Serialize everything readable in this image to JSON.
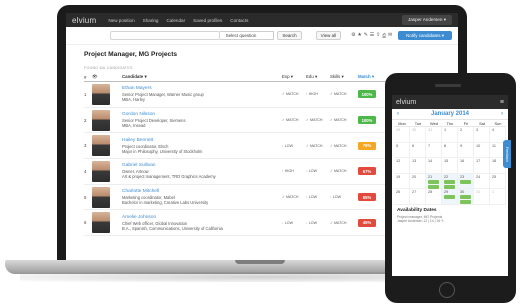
{
  "app": {
    "logo": "elvium",
    "user_menu": "Jasper Andersen ▾"
  },
  "nav": [
    "New position",
    "Sharing",
    "Calendar",
    "Saved profiles",
    "Contacts"
  ],
  "toolbar": {
    "search_placeholder": "",
    "select_label": "Select question",
    "search_button": "Search",
    "view_all": "View all",
    "icons": [
      "settings-icon",
      "star-icon",
      "edit-icon",
      "list-icon",
      "share-icon",
      "print-icon",
      "mail-icon"
    ],
    "notify_button": "Notify candidates ▾"
  },
  "page": {
    "title": "Project Manager, MG Projects",
    "found_label": "FOUND 6/6 CANDIDATES",
    "columns": {
      "num": "#",
      "candidate": "Candidate ▾",
      "exp": "Exp ▾",
      "edu": "Edu ▾",
      "skills": "Skills ▾",
      "match": "Match ▾"
    }
  },
  "candidates": [
    {
      "num": "1",
      "name": "Ethan Mayers",
      "line1": "Senior Project Manager, Warner Music group",
      "line2": "MBA, Harley",
      "exp": "MATCH",
      "edu": "HIGH",
      "skills": "MATCH",
      "match": "100%",
      "match_color": "#4cb848"
    },
    {
      "num": "2",
      "name": "Gordon Nilsson",
      "line1": "Senior Project Developer, Siemens",
      "line2": "MBA, Insead",
      "exp": "MATCH",
      "edu": "MATCH",
      "skills": "MATCH",
      "match": "100%",
      "match_color": "#4cb848"
    },
    {
      "num": "3",
      "name": "Hailey Bennett",
      "line1": "Project coordinator, Elsch",
      "line2": "Major in Philosophy, University of Stockholm",
      "exp": "LOW",
      "edu": "MATCH",
      "skills": "MATCH",
      "match": "75%",
      "match_color": "#f5a623"
    },
    {
      "num": "4",
      "name": "Gabriel Sullivan",
      "line1": "Owner, Artnow",
      "line2": "Art & project management, TRD Graphics Academy",
      "exp": "HIGH",
      "edu": "LOW",
      "skills": "MATCH",
      "match": "67%",
      "match_color": "#e24a3b"
    },
    {
      "num": "5",
      "name": "Charlotte Mitchell",
      "line1": "Marketing coordinator, Mabel",
      "line2": "Bachelor in marketing, Creative Labs University",
      "exp": "MATCH",
      "edu": "LOW",
      "skills": "LOW",
      "match": "65%",
      "match_color": "#e24a3b"
    },
    {
      "num": "6",
      "name": "Amelie Johnson",
      "line1": "Chief Web officer, Global Innovation",
      "line2": "B.A., Spanish, Communications, University of California",
      "exp": "LOW",
      "edu": "LOW",
      "skills": "MATCH",
      "match": "45%",
      "match_color": "#e24a3b"
    }
  ],
  "mobile": {
    "logo": "elvium",
    "menu_icon": "menu-icon",
    "calendar": {
      "title": "January 2014",
      "prev": "‹",
      "next": "›",
      "weekdays": [
        "Mon",
        "Tue",
        "Wed",
        "Thu",
        "Fri",
        "Sat",
        "Sun"
      ],
      "weeks": [
        [
          "29",
          "30",
          "31",
          "1",
          "2",
          "3",
          "4"
        ],
        [
          "5",
          "6",
          "7",
          "8",
          "9",
          "10",
          "11"
        ],
        [
          "12",
          "13",
          "14",
          "15",
          "16",
          "17",
          "18"
        ],
        [
          "19",
          "20",
          "21",
          "22",
          "23",
          "24",
          "25"
        ],
        [
          "26",
          "27",
          "28",
          "29",
          "30",
          "31",
          "1"
        ],
        [
          "2",
          "3",
          "4",
          "5",
          "6",
          "7",
          "8"
        ]
      ]
    },
    "availability_title": "Availability Dates",
    "availability_line1": "Project manager, MG Projects",
    "availability_line2": "Jasper Andersen  12 | 14 | 16  ✎",
    "side_tab": "Feedback"
  }
}
